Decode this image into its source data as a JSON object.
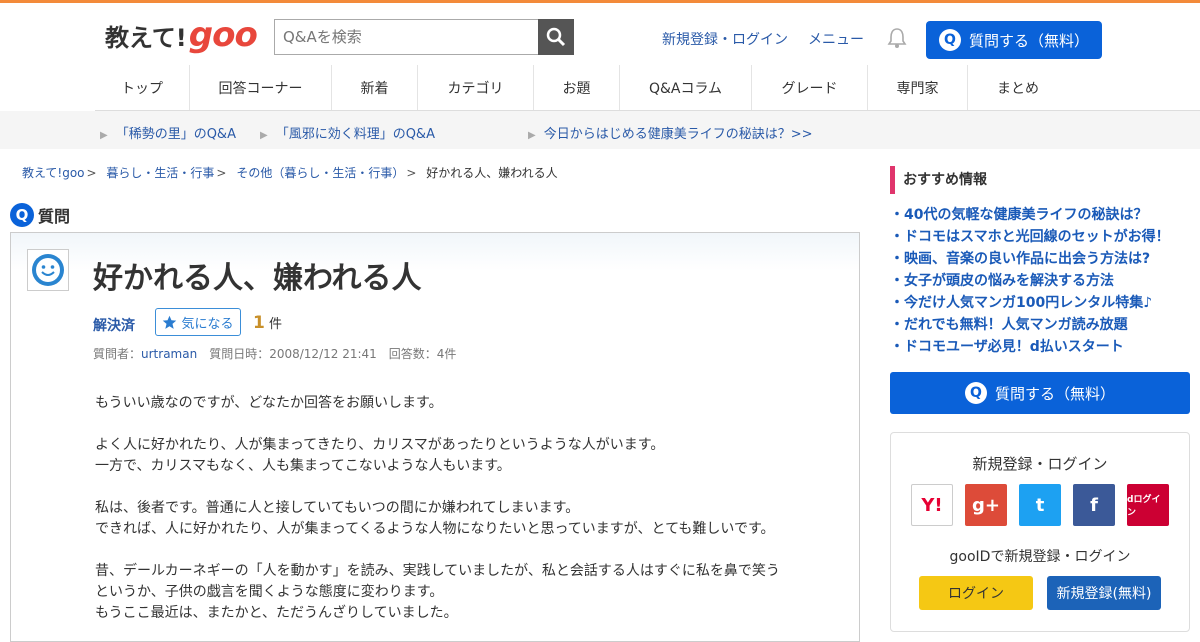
{
  "header": {
    "logo_text": "教えて!",
    "logo_brand": "goo",
    "search_placeholder": "Q&Aを検索",
    "signup_login": "新規登録・ログイン",
    "menu": "メニュー",
    "ask_button": "質問する（無料）",
    "q_glyph": "Q"
  },
  "nav": [
    {
      "label": "トップ",
      "w": 95
    },
    {
      "label": "回答コーナー",
      "w": 142
    },
    {
      "label": "新着",
      "w": 86
    },
    {
      "label": "カテゴリ",
      "w": 116
    },
    {
      "label": "お題",
      "w": 86
    },
    {
      "label": "Q&Aコラム",
      "w": 132
    },
    {
      "label": "グレード",
      "w": 116
    },
    {
      "label": "専門家",
      "w": 100
    },
    {
      "label": "まとめ",
      "w": 100
    }
  ],
  "subbar": [
    "「稀勢の里」のQ&A",
    "「風邪に効く料理」のQ&A",
    "今日からはじめる健康美ライフの秘訣は？>>"
  ],
  "breadcrumb": [
    "教えて!goo",
    "暮らし・生活・行事",
    "その他（暮らし・生活・行事）"
  ],
  "breadcrumb_current": "好かれる人、嫌われる人",
  "question": {
    "section_label": "質問",
    "title": "好かれる人、嫌われる人",
    "status": "解決済",
    "kininaru": "気になる",
    "count": "1",
    "count_unit": "件",
    "meta_asker_label": "質問者：",
    "asker": "urtraman",
    "meta_rest": "質問日時：2008/12/12 21:41　回答数：4件",
    "body": [
      "もういい歳なのですが、どなたか回答をお願いします。",
      "",
      "よく人に好かれたり、人が集まってきたり、カリスマがあったりというような人がいます。",
      "一方で、カリスマもなく、人も集まってこないような人もいます。",
      "",
      "私は、後者です。普通に人と接していてもいつの間にか嫌われてしまいます。",
      "できれば、人に好かれたり、人が集まってくるような人物になりたいと思っていますが、とても難しいです。",
      "",
      "昔、デールカーネギーの「人を動かす」を読み、実践していましたが、私と会話する人はすぐに私を鼻で笑う",
      "というか、子供の戯言を聞くような態度に変わります。",
      "もうここ最近は、またかと、ただうんざりしていました。"
    ]
  },
  "sidebar": {
    "title": "おすすめ情報",
    "items": [
      "・40代の気軽な健康美ライフの秘訣は？",
      "・ドコモはスマホと光回線のセットがお得！",
      "・映画、音楽の良い作品に出会う方法は?",
      "・女子が頭皮の悩みを解決する方法",
      "・今だけ人気マンガ100円レンタル特集♪",
      "・だれでも無料！人気マンガ読み放題",
      "・ドコモユーザ必見！d払いスタート"
    ],
    "ask_button": "質問する（無料）",
    "login_title": "新規登録・ログイン",
    "social": [
      {
        "name": "yahoo",
        "text": "Y!",
        "bg": "#ffffff",
        "fg": "#e60033"
      },
      {
        "name": "google-plus",
        "text": "g+",
        "bg": "#dd4b39",
        "fg": "#ffffff"
      },
      {
        "name": "twitter",
        "text": "t",
        "bg": "#1da1f2",
        "fg": "#ffffff"
      },
      {
        "name": "facebook",
        "text": "f",
        "bg": "#3b5998",
        "fg": "#ffffff"
      },
      {
        "name": "docomo",
        "text": "dログイン",
        "bg": "#cc0033",
        "fg": "#ffffff"
      }
    ],
    "gooid_text": "gooIDで新規登録・ログイン",
    "login_button": "ログイン",
    "signup_button": "新規登録(無料)"
  }
}
